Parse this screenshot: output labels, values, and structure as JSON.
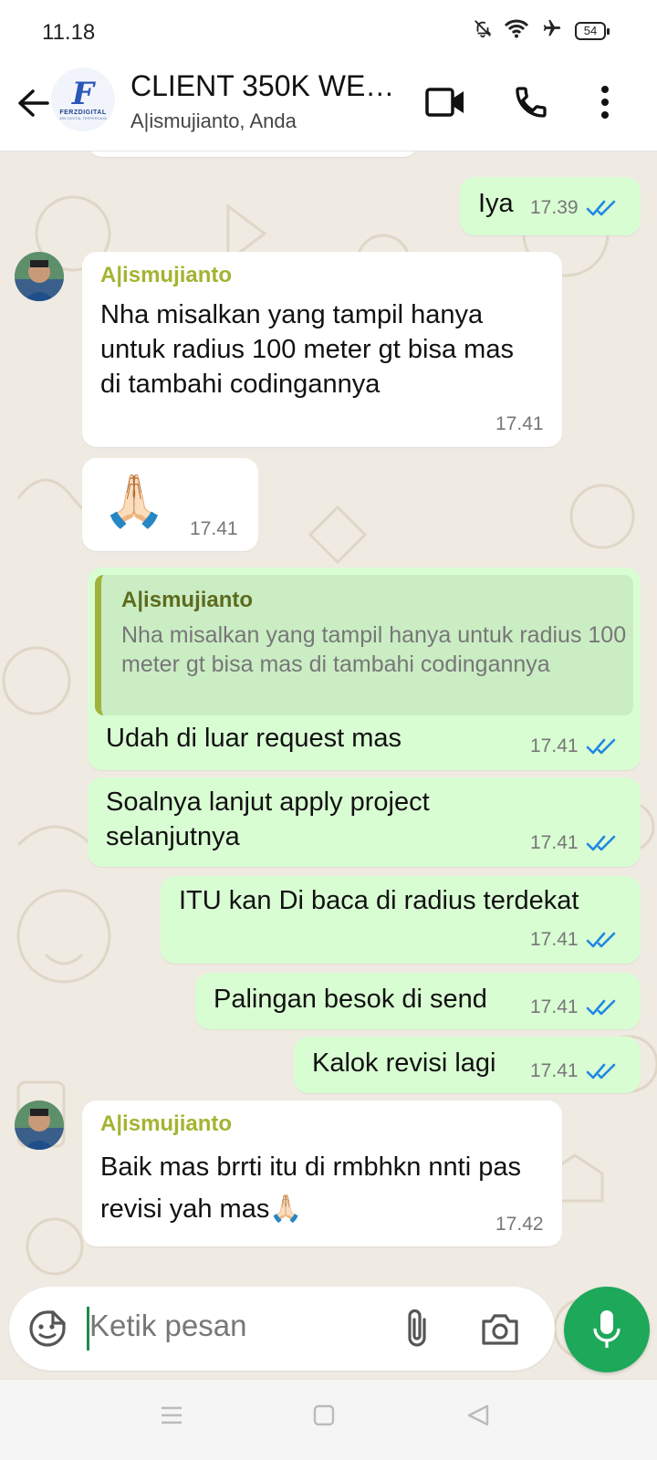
{
  "status_bar": {
    "time": "11.18",
    "battery": "54",
    "icons": [
      "mute-bell-icon",
      "wifi-icon",
      "airplane-icon",
      "battery-icon"
    ]
  },
  "header": {
    "title": "CLIENT 350K WEB...",
    "subtitle": "A|ismujianto, Anda",
    "avatar_logo": {
      "letter": "F",
      "name": "FERZDIGITAL",
      "tagline": "ASK DIGITAL TERPERCAYA"
    },
    "icons": [
      "back-arrow-icon",
      "video-call-icon",
      "phone-icon",
      "more-vert-icon"
    ]
  },
  "messages": [
    {
      "direction": "out",
      "text": "Iya",
      "time": "17.39",
      "status": "read"
    },
    {
      "direction": "in",
      "sender": "A|ismujianto",
      "text": "Nha misalkan yang tampil hanya untuk radius 100 meter gt bisa mas di tambahi codingannya",
      "time": "17.41"
    },
    {
      "direction": "in",
      "emoji": "🙏🏻",
      "time": "17.41"
    },
    {
      "direction": "out",
      "quoted": {
        "sender": "A|ismujianto",
        "text": "Nha misalkan yang tampil hanya untuk radius 100 meter gt bisa mas di tambahi codingannya"
      },
      "text": "Udah di luar request mas",
      "time": "17.41",
      "status": "read"
    },
    {
      "direction": "out",
      "text": "Soalnya lanjut apply project selanjutnya",
      "time": "17.41",
      "status": "read"
    },
    {
      "direction": "out",
      "text": "ITU kan Di baca di radius terdekat",
      "time": "17.41",
      "status": "read"
    },
    {
      "direction": "out",
      "text": "Palingan besok di send",
      "time": "17.41",
      "status": "read"
    },
    {
      "direction": "out",
      "text": "Kalok revisi lagi",
      "time": "17.41",
      "status": "read"
    },
    {
      "direction": "in",
      "sender": "A|ismujianto",
      "text": "Baik mas brrti itu di rmbhkn nnti pas revisi yah mas🙏🏻",
      "time": "17.42"
    }
  ],
  "composer": {
    "placeholder": "Ketik pesan",
    "icons": [
      "emoji-sticker-icon",
      "attach-icon",
      "camera-icon",
      "mic-icon"
    ]
  },
  "colors": {
    "outgoing_bubble": "#d9fdd3",
    "incoming_bubble": "#ffffff",
    "sender_name": "#a3b431",
    "read_ticks": "#1e88e5",
    "mic_button": "#1da85a",
    "chat_background": "#efeae2"
  }
}
